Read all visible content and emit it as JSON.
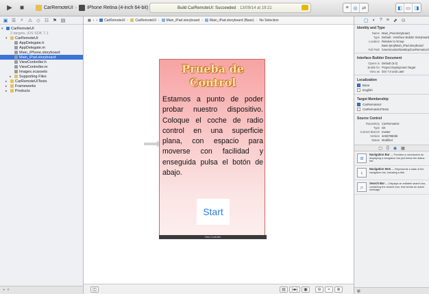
{
  "toolbar": {
    "run_icon": "run-icon",
    "stop_icon": "stop-icon",
    "scheme_target": "CarRemoteUI",
    "scheme_device": "iPhone Retina (4-inch 64-bit)",
    "activity_status": "Build CarRemoteUI: Succeeded",
    "activity_time": "13/09/14 at 19:21",
    "warning_count": "1",
    "editor_modes": [
      "≡",
      "◎",
      "⇄"
    ],
    "view_toggles": [
      "◧",
      "▭",
      "◨"
    ]
  },
  "navigator": {
    "tabs": [
      "▣",
      "☰",
      "⌕",
      "⚠",
      "◇",
      "☷",
      "⚑",
      "▤"
    ],
    "items": [
      {
        "label": "CarRemoteUI",
        "meta": "",
        "level": 0,
        "tri": "▾",
        "color": "#3b74d6",
        "selected": false
      },
      {
        "label": "2 targets, iOS SDK 7.1",
        "meta": "",
        "level": 1,
        "tri": "",
        "color": "",
        "selected": false
      },
      {
        "label": "CarRemoteUI",
        "meta": "",
        "level": 1,
        "tri": "▾",
        "color": "#e5c155",
        "selected": false
      },
      {
        "label": "AppDelegate.h",
        "meta": "",
        "level": 2,
        "tri": "",
        "color": "#9a9a9a",
        "selected": false
      },
      {
        "label": "AppDelegate.m",
        "meta": "",
        "level": 2,
        "tri": "",
        "color": "#9a9a9a",
        "selected": false
      },
      {
        "label": "Main_iPhone.storyboard",
        "meta": "",
        "level": 2,
        "tri": "",
        "color": "#9a9a9a",
        "selected": false
      },
      {
        "label": "Main_iPad.storyboard",
        "meta": "",
        "level": 2,
        "tri": "",
        "color": "#9a9a9a",
        "selected": true
      },
      {
        "label": "ViewController.h",
        "meta": "",
        "level": 2,
        "tri": "",
        "color": "#9a9a9a",
        "selected": false
      },
      {
        "label": "ViewController.m",
        "meta": "",
        "level": 2,
        "tri": "",
        "color": "#9a9a9a",
        "selected": false
      },
      {
        "label": "Images.xcassets",
        "meta": "",
        "level": 2,
        "tri": "",
        "color": "#9a9a9a",
        "selected": false
      },
      {
        "label": "Supporting Files",
        "meta": "",
        "level": 2,
        "tri": "▸",
        "color": "#e5c155",
        "selected": false
      },
      {
        "label": "CarRemoteUITests",
        "meta": "",
        "level": 1,
        "tri": "▸",
        "color": "#e5c155",
        "selected": false
      },
      {
        "label": "Frameworks",
        "meta": "",
        "level": 1,
        "tri": "▸",
        "color": "#e5c155",
        "selected": false
      },
      {
        "label": "Products",
        "meta": "",
        "level": 1,
        "tri": "▸",
        "color": "#e5c155",
        "selected": false
      }
    ],
    "filter_icon": "add-icon"
  },
  "jumpbar": {
    "crumbs": [
      "CarRemoteUI",
      "CarRemoteUI",
      "Main_iPad.storyboard",
      "Main_iPad.storyboard (Base)",
      "No Selection"
    ]
  },
  "scene": {
    "title": "Prueba de Control",
    "body": "Estamos a punto de poder probar nuestro dispositivo. Coloque el coche de radio control en una superficie plana, con espacio para moverse con facilidad y enseguida pulsa el botón de abajo.",
    "button_label": "Start",
    "dock_label": "View Controller"
  },
  "canvas_bar": {
    "outline_toggle": "◫",
    "size_labels": [
      "▤",
      "|◂▸|",
      "▣"
    ],
    "zoom": [
      "⊖",
      "=",
      "⊕"
    ]
  },
  "inspector": {
    "tabs": [
      "▢",
      "◐",
      "?",
      "≡",
      "⬈",
      "⊙"
    ],
    "identity_title": "Identity and Type",
    "identity": [
      {
        "k": "Name",
        "v": "Main_iPad.storyboard"
      },
      {
        "k": "Type",
        "v": "Default - Interface Builder Storyboard"
      },
      {
        "k": "Location",
        "v": "Relative to Group"
      },
      {
        "k": "",
        "v": "Base.lproj/Main_iPad.storyboard"
      },
      {
        "k": "Full Path",
        "v": "/Users/carlos/Desktop/CarRemoteUI/CarRemoteUI/Base.lproj/Main_iPad.storyboard"
      }
    ],
    "doc_title": "Interface Builder Document",
    "doc": [
      {
        "k": "Opens in",
        "v": "Default (5.0)"
      },
      {
        "k": "Builds for",
        "v": "Project Deployment Target"
      },
      {
        "k": "View as",
        "v": "iOS 7.0 and Later"
      }
    ],
    "localization_title": "Localization",
    "localization": [
      {
        "label": "Base",
        "checked": true
      },
      {
        "label": "English",
        "checked": false
      }
    ],
    "target_title": "Target Membership",
    "targets": [
      {
        "label": "CarRemoteUI",
        "checked": true
      },
      {
        "label": "CarRemoteUITests",
        "checked": false
      }
    ],
    "source_title": "Source Control",
    "source": [
      {
        "k": "Repository",
        "v": "CarRemoteUI"
      },
      {
        "k": "Type",
        "v": "Git"
      },
      {
        "k": "Current Branch",
        "v": "master"
      },
      {
        "k": "Version",
        "v": "4e9d7860d5"
      },
      {
        "k": "Status",
        "v": "Modified"
      }
    ]
  },
  "library": {
    "tabs": [
      "▢",
      "{}",
      "◉",
      "▦"
    ],
    "items": [
      {
        "icon": "≡",
        "title": "Navigation Bar",
        "desc": "Provides a mechanism for displaying a navigation bar just below the status bar."
      },
      {
        "icon": "‹",
        "title": "Navigation Item",
        "desc": "Represents a state of the navigation bar, including a title."
      },
      {
        "icon": "⌕",
        "title": "Search Bar",
        "desc": "Displays an editable search bar, containing the search icon, that sends an action message."
      }
    ],
    "filter_icon": "grid-view-icon"
  }
}
